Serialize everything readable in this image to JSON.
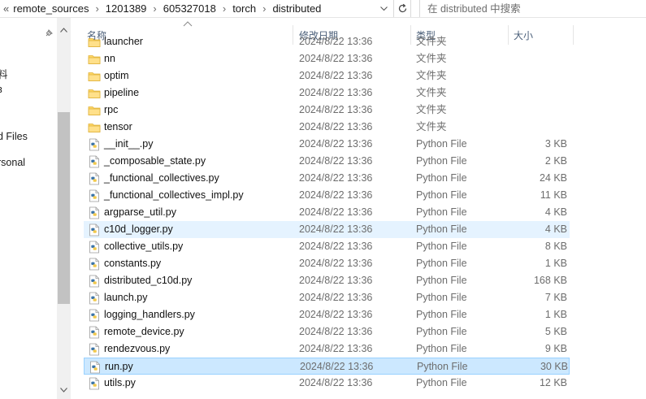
{
  "address_bar": {
    "lead": "«",
    "segments": [
      "remote_sources",
      "1201389",
      "605327018",
      "torch",
      "distributed"
    ]
  },
  "search": {
    "placeholder": "在 distributed 中搜索"
  },
  "nav_pane": {
    "items": [
      "料",
      "ɜ",
      "d Files",
      "rsonal"
    ]
  },
  "columns": {
    "name": "名称",
    "date": "修改日期",
    "type": "类型",
    "size": "大小"
  },
  "files": [
    {
      "name": "launcher",
      "date": "2024/8/22 13:36",
      "type": "文件夹",
      "size": "",
      "icon": "folder-icon"
    },
    {
      "name": "nn",
      "date": "2024/8/22 13:36",
      "type": "文件夹",
      "size": "",
      "icon": "folder-icon"
    },
    {
      "name": "optim",
      "date": "2024/8/22 13:36",
      "type": "文件夹",
      "size": "",
      "icon": "folder-icon"
    },
    {
      "name": "pipeline",
      "date": "2024/8/22 13:36",
      "type": "文件夹",
      "size": "",
      "icon": "folder-icon"
    },
    {
      "name": "rpc",
      "date": "2024/8/22 13:36",
      "type": "文件夹",
      "size": "",
      "icon": "folder-icon"
    },
    {
      "name": "tensor",
      "date": "2024/8/22 13:36",
      "type": "文件夹",
      "size": "",
      "icon": "folder-icon"
    },
    {
      "name": "__init__.py",
      "date": "2024/8/22 13:36",
      "type": "Python File",
      "size": "3 KB",
      "icon": "python-file-icon"
    },
    {
      "name": "_composable_state.py",
      "date": "2024/8/22 13:36",
      "type": "Python File",
      "size": "2 KB",
      "icon": "python-file-icon"
    },
    {
      "name": "_functional_collectives.py",
      "date": "2024/8/22 13:36",
      "type": "Python File",
      "size": "24 KB",
      "icon": "python-file-icon"
    },
    {
      "name": "_functional_collectives_impl.py",
      "date": "2024/8/22 13:36",
      "type": "Python File",
      "size": "11 KB",
      "icon": "python-file-icon"
    },
    {
      "name": "argparse_util.py",
      "date": "2024/8/22 13:36",
      "type": "Python File",
      "size": "4 KB",
      "icon": "python-file-icon"
    },
    {
      "name": "c10d_logger.py",
      "date": "2024/8/22 13:36",
      "type": "Python File",
      "size": "4 KB",
      "icon": "python-file-icon"
    },
    {
      "name": "collective_utils.py",
      "date": "2024/8/22 13:36",
      "type": "Python File",
      "size": "8 KB",
      "icon": "python-file-icon"
    },
    {
      "name": "constants.py",
      "date": "2024/8/22 13:36",
      "type": "Python File",
      "size": "1 KB",
      "icon": "python-file-icon"
    },
    {
      "name": "distributed_c10d.py",
      "date": "2024/8/22 13:36",
      "type": "Python File",
      "size": "168 KB",
      "icon": "python-file-icon"
    },
    {
      "name": "launch.py",
      "date": "2024/8/22 13:36",
      "type": "Python File",
      "size": "7 KB",
      "icon": "python-file-icon"
    },
    {
      "name": "logging_handlers.py",
      "date": "2024/8/22 13:36",
      "type": "Python File",
      "size": "1 KB",
      "icon": "python-file-icon"
    },
    {
      "name": "remote_device.py",
      "date": "2024/8/22 13:36",
      "type": "Python File",
      "size": "5 KB",
      "icon": "python-file-icon"
    },
    {
      "name": "rendezvous.py",
      "date": "2024/8/22 13:36",
      "type": "Python File",
      "size": "9 KB",
      "icon": "python-file-icon"
    },
    {
      "name": "run.py",
      "date": "2024/8/22 13:36",
      "type": "Python File",
      "size": "30 KB",
      "icon": "python-file-icon"
    },
    {
      "name": "utils.py",
      "date": "2024/8/22 13:36",
      "type": "Python File",
      "size": "12 KB",
      "icon": "python-file-icon"
    }
  ],
  "state": {
    "hovered_row": 11,
    "selected_row": 19
  },
  "colors": {
    "hover": "#e5f3ff",
    "selected": "#cce8ff",
    "selected_border": "#99d1ff",
    "header_text": "#4c607a",
    "folder": "#ffd766",
    "python_blue": "#3b74a8",
    "python_yellow": "#f2c94c"
  }
}
